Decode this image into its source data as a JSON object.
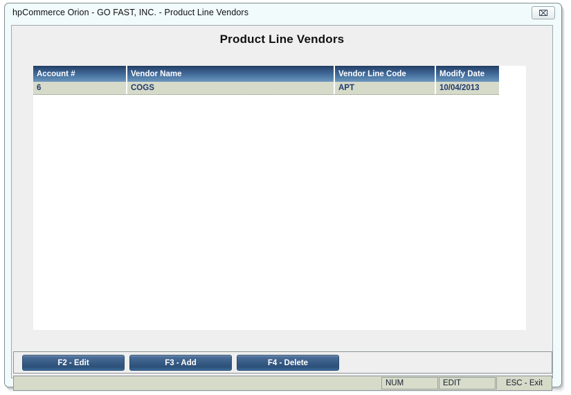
{
  "window": {
    "title": "hpCommerce Orion - GO FAST, INC. - Product Line Vendors",
    "close_label": "⌧",
    "close_icon_name": "close-icon"
  },
  "page": {
    "heading": "Product Line Vendors"
  },
  "grid": {
    "columns": [
      {
        "label": "Account #"
      },
      {
        "label": "Vendor Name"
      },
      {
        "label": "Vendor Line Code"
      },
      {
        "label": "Modify Date"
      }
    ],
    "rows": [
      {
        "account": "6",
        "vendor_name": "COGS",
        "vendor_line_code": "APT",
        "modify_date": "10/04/2013"
      }
    ]
  },
  "buttons": [
    {
      "label": "F2 - Edit"
    },
    {
      "label": "F3 - Add"
    },
    {
      "label": "F4 - Delete"
    }
  ],
  "status": {
    "num": "NUM",
    "edit": "EDIT",
    "exit": "ESC - Exit"
  },
  "colors": {
    "header_gradient_top": "#203b5f",
    "header_gradient_bottom": "#6d97bd",
    "row_background": "#d6dac9",
    "row_text": "#1f3a6b",
    "button_blue": "#345982",
    "client_background": "#efefef",
    "titlebar_background": "#f2fbfb"
  }
}
